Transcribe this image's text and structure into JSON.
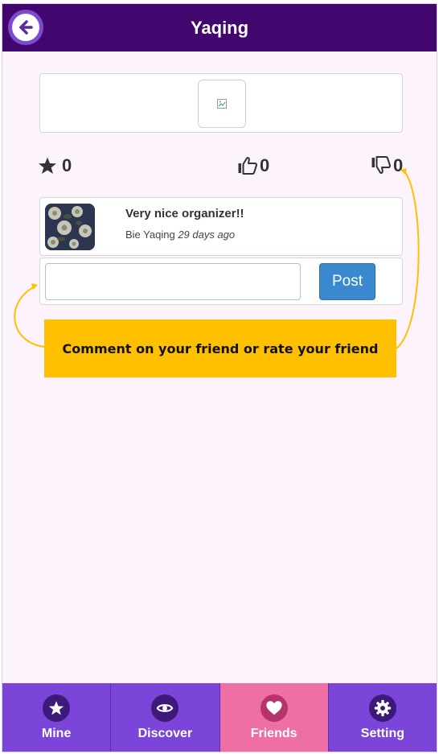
{
  "header": {
    "title": "Yaqing",
    "back_icon": "arrow-left-icon"
  },
  "stats": {
    "stars": "0",
    "likes": "0",
    "dislikes": "0"
  },
  "comment": {
    "text": "Very nice organizer!!",
    "author": "Bie Yaqing",
    "time": "29 days ago"
  },
  "composer": {
    "value": "",
    "placeholder": "",
    "post_label": "Post"
  },
  "callout": {
    "text": "Comment on your friend or rate your friend",
    "color": "#ffc000"
  },
  "nav": {
    "items": [
      {
        "label": "Mine",
        "icon": "star-icon"
      },
      {
        "label": "Discover",
        "icon": "eye-icon"
      },
      {
        "label": "Friends",
        "icon": "heart-icon",
        "active": true
      },
      {
        "label": "Setting",
        "icon": "gear-icon"
      }
    ]
  },
  "colors": {
    "header_bg": "#42066f",
    "nav_bg": "#7a45d8",
    "nav_active_bg": "#ee6fa3",
    "post_button": "#3a89ce",
    "page_bg": "#fdf3fc"
  }
}
